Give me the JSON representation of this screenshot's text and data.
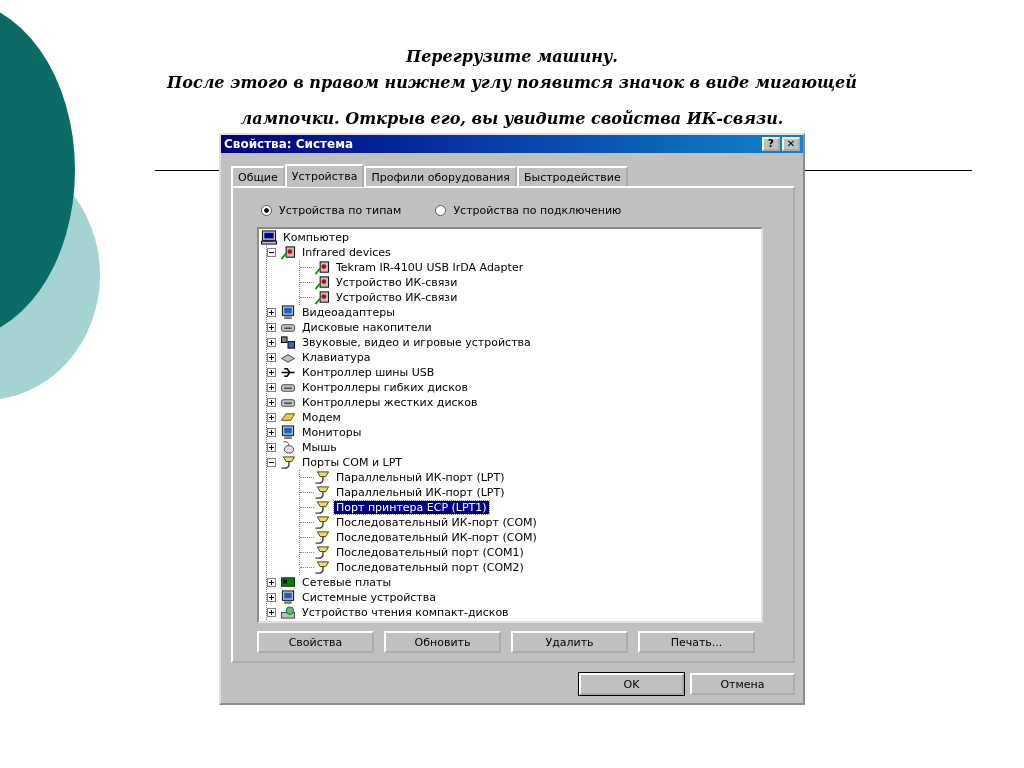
{
  "slide": {
    "heading_lines": [
      "Перегрузите машину.",
      "После этого в правом нижнем углу появится значок в виде мигающей",
      "лампочки. Открыв его, вы увидите свойства ИК-связи."
    ]
  },
  "window": {
    "title": "Свойства: Система",
    "title_buttons": [
      "?",
      "✕"
    ],
    "tabs": [
      {
        "label": "Общие",
        "selected": false
      },
      {
        "label": "Устройства",
        "selected": true
      },
      {
        "label": "Профили оборудования",
        "selected": false
      },
      {
        "label": "Быстродействие",
        "selected": false
      }
    ],
    "view_options": [
      {
        "label": "Устройства по типам",
        "selected": true
      },
      {
        "label": "Устройства по подключению",
        "selected": false
      }
    ],
    "tree": [
      {
        "label": "Компьютер",
        "kind": "computer",
        "selected": false,
        "children": [
          {
            "label": "Infrared devices",
            "kind": "infrared",
            "expanded": true,
            "selected": false,
            "children": [
              {
                "label": "Tekram IR-410U USB IrDA Adapter",
                "kind": "infrared",
                "selected": false
              },
              {
                "label": "Устройство ИК-связи",
                "kind": "infrared",
                "selected": false
              },
              {
                "label": "Устройство ИК-связи",
                "kind": "infrared",
                "selected": false
              }
            ]
          },
          {
            "label": "Видеоадаптеры",
            "kind": "display",
            "expanded": false,
            "selected": false
          },
          {
            "label": "Дисковые накопители",
            "kind": "drive",
            "expanded": false,
            "selected": false
          },
          {
            "label": "Звуковые, видео и игровые устройства",
            "kind": "sound",
            "expanded": false,
            "selected": false
          },
          {
            "label": "Клавиатура",
            "kind": "keyboard",
            "expanded": false,
            "selected": false
          },
          {
            "label": "Контроллер шины USB",
            "kind": "usb",
            "expanded": false,
            "selected": false
          },
          {
            "label": "Контроллеры гибких дисков",
            "kind": "drive",
            "expanded": false,
            "selected": false
          },
          {
            "label": "Контроллеры жестких дисков",
            "kind": "drive",
            "expanded": false,
            "selected": false
          },
          {
            "label": "Модем",
            "kind": "modem",
            "expanded": false,
            "selected": false
          },
          {
            "label": "Мониторы",
            "kind": "display",
            "expanded": false,
            "selected": false
          },
          {
            "label": "Мышь",
            "kind": "mouse",
            "expanded": false,
            "selected": false
          },
          {
            "label": "Порты COM и LPT",
            "kind": "port",
            "expanded": true,
            "selected": false,
            "children": [
              {
                "label": "Параллельный ИК-порт (LPT)",
                "kind": "port",
                "selected": false
              },
              {
                "label": "Параллельный ИК-порт (LPT)",
                "kind": "port",
                "selected": false
              },
              {
                "label": "Порт принтера ECP (LPT1)",
                "kind": "port",
                "selected": true
              },
              {
                "label": "Последовательный ИК-порт (COM)",
                "kind": "port",
                "selected": false
              },
              {
                "label": "Последовательный ИК-порт (COM)",
                "kind": "port",
                "selected": false
              },
              {
                "label": "Последовательный порт (COM1)",
                "kind": "port",
                "selected": false
              },
              {
                "label": "Последовательный порт (COM2)",
                "kind": "port",
                "selected": false
              }
            ]
          },
          {
            "label": "Сетевые платы",
            "kind": "network",
            "expanded": false,
            "selected": false
          },
          {
            "label": "Системные устройства",
            "kind": "display",
            "expanded": false,
            "selected": false
          },
          {
            "label": "Устройство чтения компакт-дисков",
            "kind": "cdrom",
            "expanded": false,
            "selected": false
          }
        ]
      }
    ],
    "action_buttons": [
      "Свойства",
      "Обновить",
      "Удалить",
      "Печать..."
    ],
    "dialog_buttons": [
      "OK",
      "Отмена"
    ]
  }
}
